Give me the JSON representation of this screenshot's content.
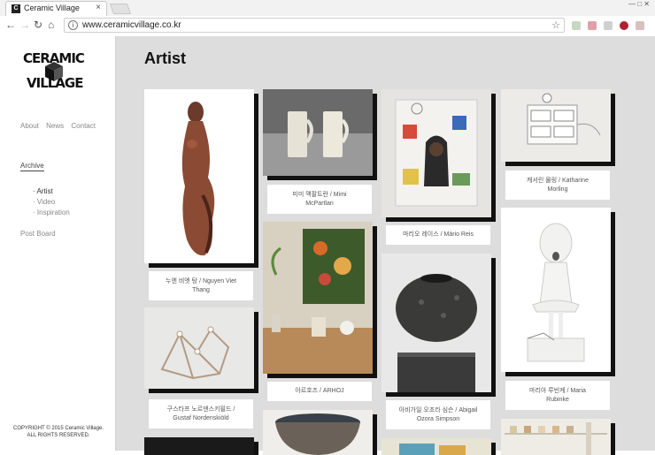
{
  "browser": {
    "tab_title": "Ceramic Village",
    "tab_favicon": "C",
    "url": "www.ceramicvillage.co.kr",
    "controls": "—  □  ✕"
  },
  "logo": {
    "line1": "CERAMIC",
    "line2": "VILLAGE"
  },
  "sidebar": {
    "nav": [
      "About",
      "News",
      "Contact"
    ],
    "archive": "Archive",
    "sub_items": [
      "Artist",
      "Video",
      "Inspiration"
    ],
    "post_board": "Post Board",
    "copyright_1": "COPYRIGHT © 2015 Ceramic Village.",
    "copyright_2": "ALL RIGHTS RESERVED."
  },
  "main": {
    "title": "Artist",
    "artists": [
      {
        "line1": "누엔 비엣 탕 / Nguyen Viet",
        "line2": "Thang"
      },
      {
        "line1": "미미 맥팔트란 / Mimi",
        "line2": "McPartlan"
      },
      {
        "line1": "마리오 레이스 / Mário Reis",
        "line2": ""
      },
      {
        "line1": "캐서린 몰링 / Katharine",
        "line2": "Morling"
      },
      {
        "line1": "구스타프 노르덴스키욀드 /",
        "line2": "Gustaf Nordenskiöld"
      },
      {
        "line1": "아르호즈 / ARHOJ",
        "line2": ""
      },
      {
        "line1": "아비가일 오조라 심슨 / Abigail",
        "line2": "Ozora Simpson"
      },
      {
        "line1": "마리아 루빈케 / Maria",
        "line2": "Rubinke"
      }
    ]
  }
}
